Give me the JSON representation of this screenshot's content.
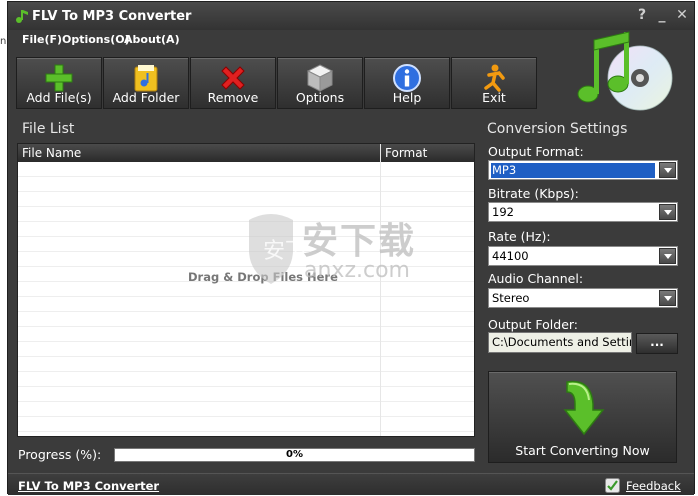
{
  "window": {
    "title": "FLV To MP3 Converter",
    "controls": {
      "help": "?",
      "minimize": "_",
      "close": "✕"
    }
  },
  "menu": [
    {
      "label": "File(F)"
    },
    {
      "label": "Options(O)"
    },
    {
      "label": "About(A)"
    }
  ],
  "toolbar": {
    "add_files": "Add File(s)",
    "add_folder": "Add Folder",
    "remove": "Remove",
    "options": "Options",
    "help": "Help",
    "exit": "Exit"
  },
  "file_list": {
    "title": "File List",
    "columns": [
      "File Name",
      "Format"
    ],
    "placeholder": "Drag & Drop Files Here"
  },
  "settings": {
    "title": "Conversion Settings",
    "output_format": {
      "label": "Output Format:",
      "value": "MP3"
    },
    "bitrate": {
      "label": "Bitrate (Kbps):",
      "value": "192"
    },
    "rate": {
      "label": "Rate (Hz):",
      "value": "44100"
    },
    "channel": {
      "label": "Audio Channel:",
      "value": "Stereo"
    },
    "output_folder": {
      "label": "Output Folder:",
      "value": "C:\\Documents and Settin",
      "browse": "..."
    }
  },
  "start_button": "Start Converting Now",
  "progress": {
    "label": "Progress (%):",
    "value": 0,
    "text": "0%"
  },
  "status": {
    "app_link": "FLV To MP3 Converter",
    "feedback": "Feedback"
  },
  "watermark": {
    "text": "安下载",
    "domain": "anxz.com"
  },
  "colors": {
    "accent_green": "#5bbf2a",
    "selection_blue": "#1f5fc4",
    "remove_red": "#e02020",
    "help_blue": "#2f6fe0",
    "exit_orange": "#f29a10"
  }
}
